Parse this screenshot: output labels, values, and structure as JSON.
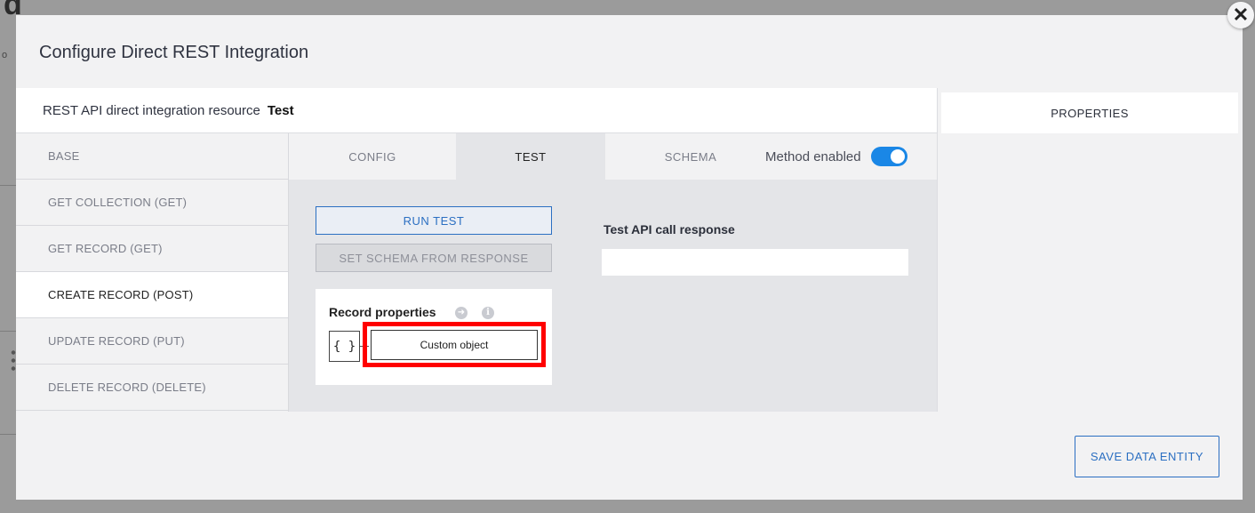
{
  "background": {
    "letter": "d",
    "dot_text": "o"
  },
  "modal": {
    "title": "Configure Direct REST Integration",
    "close_glyph": "✕"
  },
  "resource": {
    "label": "REST API direct integration resource",
    "value": "Test"
  },
  "sidebar": {
    "items": [
      {
        "label": "BASE"
      },
      {
        "label": "GET COLLECTION (GET)"
      },
      {
        "label": "GET RECORD (GET)"
      },
      {
        "label": "CREATE RECORD (POST)",
        "active": true
      },
      {
        "label": "UPDATE RECORD (PUT)"
      },
      {
        "label": "DELETE RECORD (DELETE)"
      }
    ]
  },
  "tabs": [
    {
      "label": "CONFIG"
    },
    {
      "label": "TEST",
      "active": true
    },
    {
      "label": "SCHEMA"
    }
  ],
  "method": {
    "label": "Method enabled",
    "enabled": true,
    "toggle_color": "#1a87e6"
  },
  "test": {
    "run_label": "RUN TEST",
    "set_schema_label": "SET SCHEMA FROM RESPONSE",
    "response_label": "Test API call response",
    "response_value": ""
  },
  "record": {
    "title": "Record properties",
    "braces": "{ }",
    "custom_object_label": "Custom object",
    "arrow_icon": "arrow-right-circle-icon",
    "info_icon": "info-icon",
    "info_glyph": "i",
    "arrow_glyph": "➜",
    "highlight_color": "#ff0000"
  },
  "properties": {
    "header": "PROPERTIES"
  },
  "footer": {
    "save_label": "SAVE DATA ENTITY"
  }
}
